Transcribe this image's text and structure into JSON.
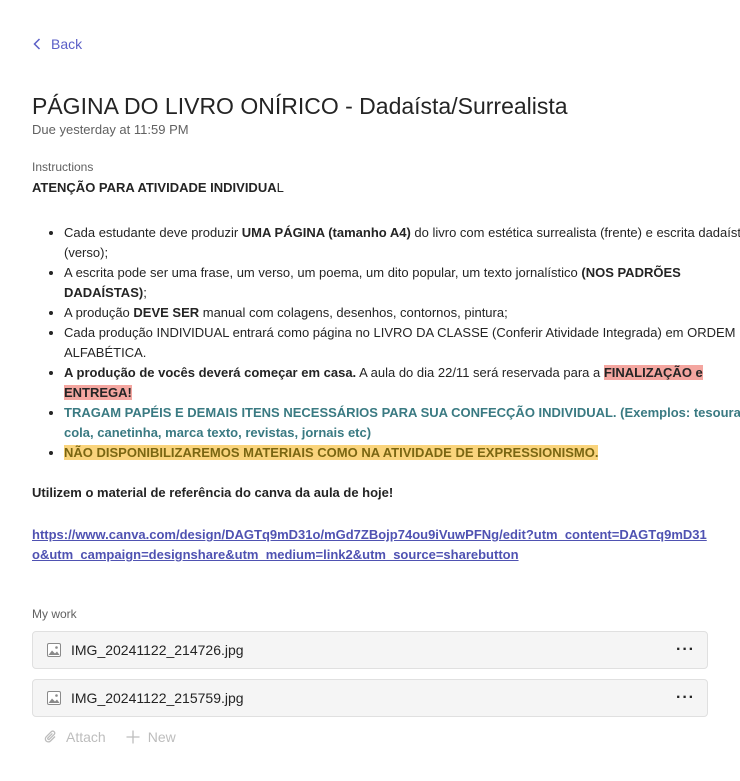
{
  "nav": {
    "back_label": "Back"
  },
  "assignment": {
    "title": "PÁGINA DO LIVRO ONÍRICO - Dadaísta/Surrealista",
    "due": "Due yesterday at 11:59 PM"
  },
  "instructions": {
    "label": "Instructions",
    "attention_main": "ATENÇÃO PARA ATIVIDADE INDIVIDUA",
    "attention_last": "L",
    "items": [
      {
        "pre": "Cada estudante deve produzir ",
        "bold": "UMA PÁGINA (tamanho A4)",
        "post": " do livro com estética surrealista (frente) e escrita dadaísta (verso);"
      },
      {
        "pre": "A escrita pode ser uma frase, um verso, um poema, um dito popular, um texto jornalístico ",
        "bold": "(NOS PADRÕES DADAÍSTAS)",
        "post": ";"
      },
      {
        "pre": "A produção ",
        "bold": "DEVE SER",
        "post": " manual com colagens, desenhos, contornos, pintura;"
      },
      {
        "text": "Cada produção INDIVIDUAL entrará como página no LIVRO DA CLASSE (Conferir Atividade Integrada) em ORDEM ALFABÉTICA."
      },
      {
        "bold": "A produção de vocês deverá começar em casa.",
        "post": " A aula do dia 22/11 será reservada para a ",
        "highlight": "FINALIZAÇÃO e ENTREGA!"
      },
      {
        "teal": "TRAGAM PAPÉIS E DEMAIS ITENS NECESSÁRIOS PARA SUA CONFECÇÃO INDIVIDUAL. (Exemplos: tesoura, cola, canetinha, marca texto, revistas, jornais etc)"
      },
      {
        "highlight": "NÃO DISPONIBILIZAREMOS MATERIAIS COMO NA ATIVIDADE DE EXPRESSIONISMO."
      }
    ],
    "reference_text": "Utilizem o material de referência do canva da aula de hoje!",
    "link": "https://www.canva.com/design/DAGTq9mD31o/mGd7ZBojp74ou9iVuwPFNg/edit?utm_content=DAGTq9mD31o&utm_campaign=designshare&utm_medium=link2&utm_source=sharebutton"
  },
  "my_work": {
    "label": "My work",
    "files": [
      {
        "name": "IMG_20241122_214726.jpg",
        "icon": "image-file-icon",
        "menu": "···"
      },
      {
        "name": "IMG_20241122_215759.jpg",
        "icon": "image-file-icon",
        "menu": "···"
      }
    ],
    "attach_label": "Attach",
    "new_label": "New"
  },
  "colors": {
    "accent": "#5b5fc7",
    "link": "#4f52b2",
    "highlight_red": "#f4a6a0",
    "teal_text": "#3a7a82",
    "highlight_orange": "#fad47c"
  }
}
